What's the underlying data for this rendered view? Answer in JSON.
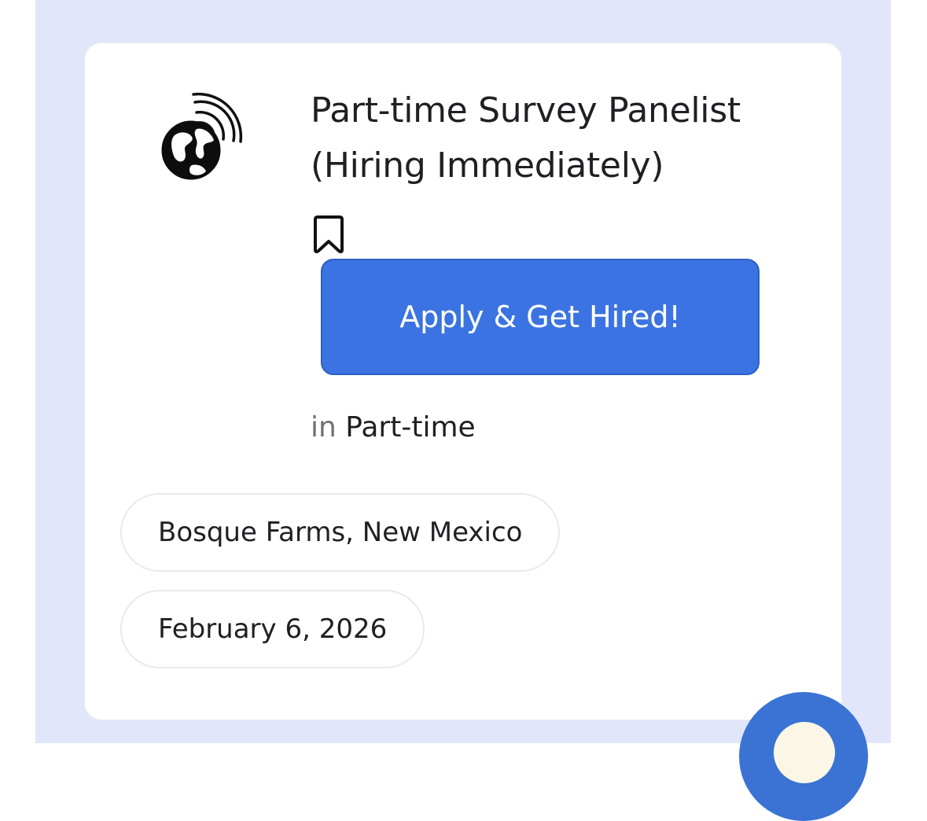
{
  "job": {
    "title_line1": "Part-time Survey Panelist",
    "title_line2": "(Hiring Immediately)",
    "apply_label": "Apply & Get Hired!",
    "category_prefix": "in",
    "category": "Part-time",
    "location": "Bosque Farms, New Mexico",
    "date": "February 6, 2026"
  },
  "icons": {
    "logo": "globe-broadcast-logo",
    "bookmark": "bookmark-icon",
    "fab": "chat-bubble-icon"
  },
  "colors": {
    "page_background": "#e1e6fb",
    "card_background": "#ffffff",
    "apply_button": "#3b74e2",
    "fab": "#3a73d4",
    "text": "#1f1f24",
    "muted_text": "#6f6f74"
  }
}
